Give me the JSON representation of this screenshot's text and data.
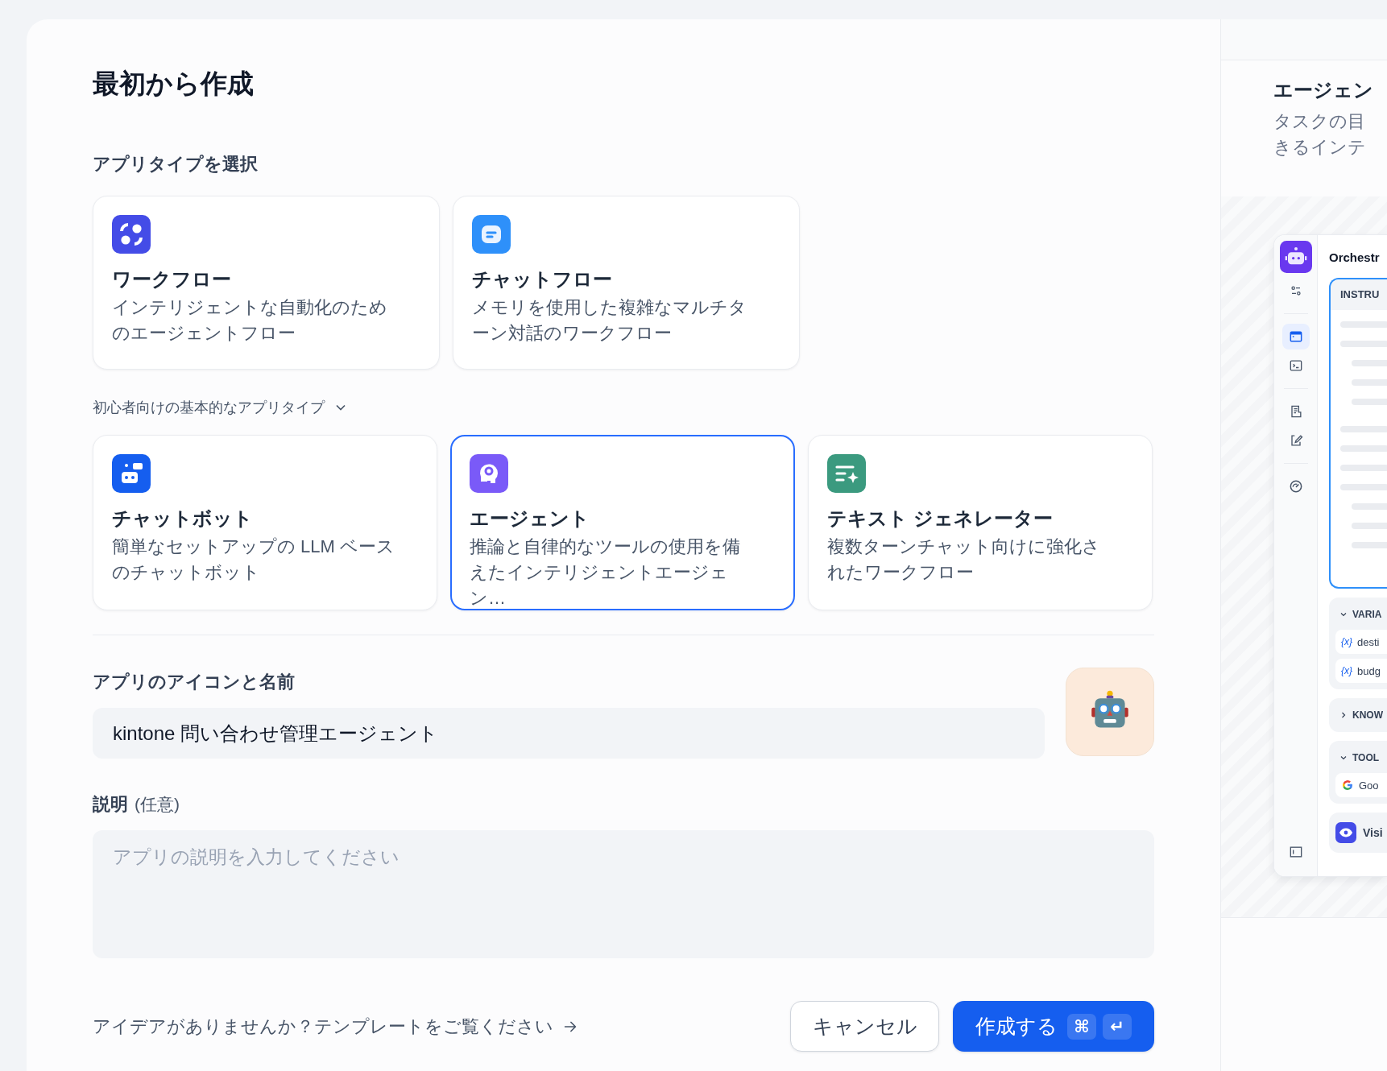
{
  "dialog": {
    "title": "最初から作成"
  },
  "app_type": {
    "heading": "アプリタイプを選択",
    "primary_types": [
      {
        "kind": "workflow",
        "title": "ワークフロー",
        "description": "インテリジェントな自動化のためのエージェントフロー",
        "selected": false
      },
      {
        "kind": "chatflow",
        "title": "チャットフロー",
        "description": "メモリを使用した複雑なマルチターン対話のワークフロー",
        "selected": false
      }
    ],
    "beginner_toggle": {
      "label": "初心者向けの基本的なアプリタイプ",
      "expanded": true
    },
    "beginner_types": [
      {
        "kind": "chatbot",
        "title": "チャットボット",
        "description": "簡単なセットアップの LLM ベースのチャットボット",
        "selected": false
      },
      {
        "kind": "agent",
        "title": "エージェント",
        "description": "推論と自律的なツールの使用を備えたインテリジェントエージェン…",
        "selected": true
      },
      {
        "kind": "text_generator",
        "title": "テキスト ジェネレーター",
        "description": "複数ターンチャット向けに強化されたワークフロー",
        "selected": false
      }
    ]
  },
  "name_section": {
    "heading": "アプリのアイコンと名前",
    "name_value": "kintone 問い合わせ管理エージェント"
  },
  "description_section": {
    "label": "説明",
    "optional": "(任意)",
    "placeholder": "アプリの説明を入力してください"
  },
  "footer": {
    "template_link": "アイデアがありませんか？テンプレートをご覧ください",
    "cancel": "キャンセル",
    "create": "作成する",
    "shortcut_keys": [
      "⌘",
      "↵"
    ]
  },
  "preview": {
    "title": "エージェン",
    "description_lines": [
      "タスクの目",
      "きるインテ"
    ],
    "app": {
      "name": "Orchestr",
      "instruction_label": "INSTRU",
      "nav_groups": [
        [
          {
            "kind": "sliders",
            "selected": false
          }
        ],
        [
          {
            "kind": "app",
            "selected": true
          },
          {
            "kind": "terminal",
            "selected": false
          }
        ],
        [
          {
            "kind": "document",
            "selected": false
          },
          {
            "kind": "edit",
            "selected": false
          }
        ],
        [
          {
            "kind": "gauge",
            "selected": false
          }
        ]
      ],
      "sections": [
        {
          "label": "VARIA",
          "expanded": true,
          "items": [
            {
              "kind": "variable",
              "icon_text": "{x}",
              "text": "desti"
            },
            {
              "kind": "variable",
              "icon_text": "{x}",
              "text": "budg"
            }
          ]
        },
        {
          "label": "KNOW",
          "expanded": false
        },
        {
          "label": "TOOL",
          "expanded": true,
          "items": [
            {
              "kind": "google",
              "text": "Goo"
            }
          ]
        }
      ],
      "vision_label": "Visi"
    }
  }
}
